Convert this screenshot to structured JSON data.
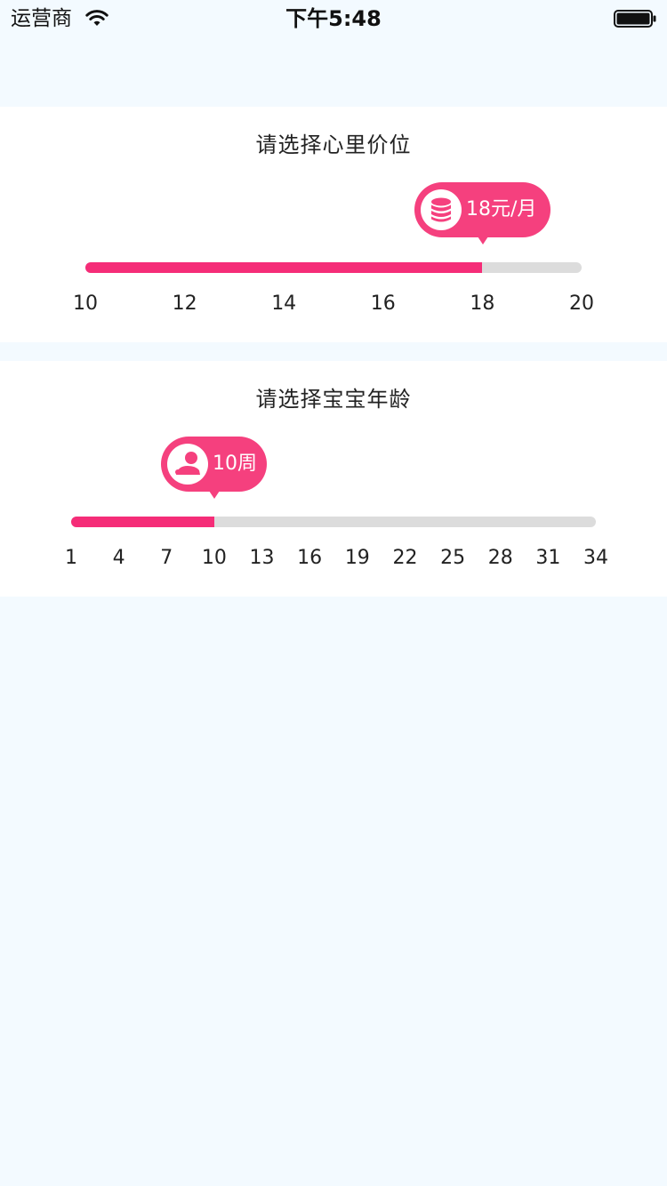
{
  "status_bar": {
    "carrier": "运营商",
    "time": "下午5:48"
  },
  "price_slider": {
    "title": "请选择心里价位",
    "value_label": "18元/月",
    "icon": "coin-stack-icon",
    "min": 10,
    "max": 20,
    "value": 18,
    "ticks": [
      "10",
      "12",
      "14",
      "16",
      "18",
      "20"
    ]
  },
  "age_slider": {
    "title": "请选择宝宝年龄",
    "value_label": "10周",
    "icon": "baby-icon",
    "min": 1,
    "max": 34,
    "value": 10,
    "ticks": [
      "1",
      "4",
      "7",
      "10",
      "13",
      "16",
      "19",
      "22",
      "25",
      "28",
      "31",
      "34"
    ]
  },
  "colors": {
    "accent": "#f52d78",
    "bubble": "#f5407e",
    "track": "#dcdcdc",
    "page_background": "#f3faff"
  }
}
